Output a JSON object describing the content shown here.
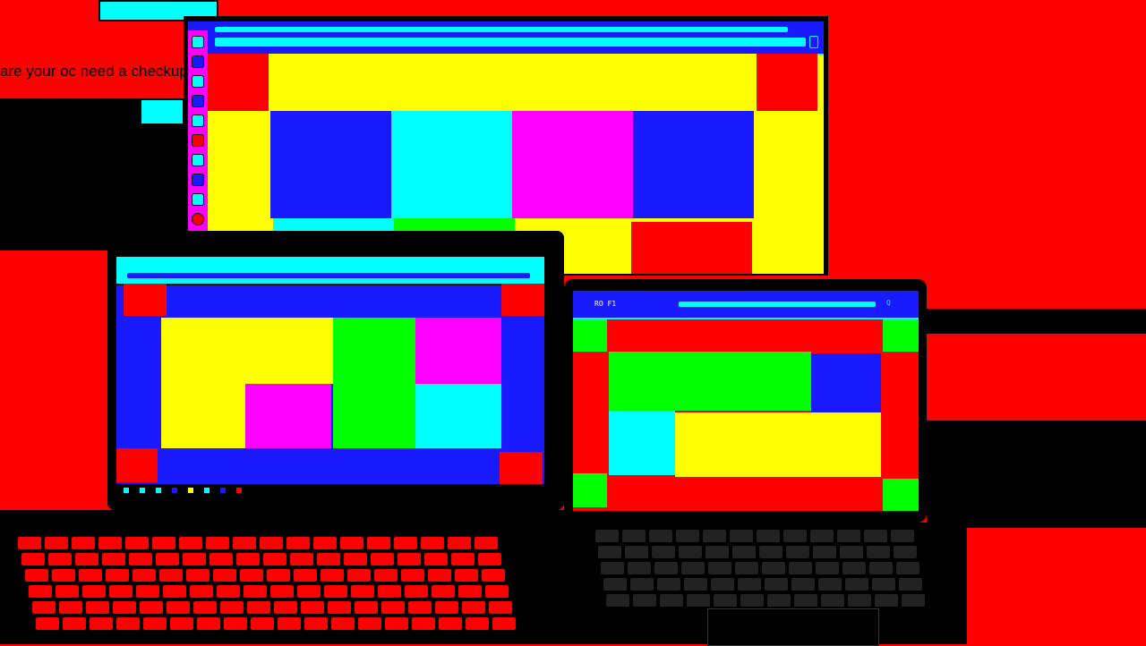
{
  "background_text": "are your oc need a checkup",
  "colors": {
    "wall": "#ff0000",
    "bezel": "#000000",
    "accent_blue": "#1a1aff",
    "accent_cyan": "#00ffff",
    "accent_yellow": "#ffff00",
    "accent_magenta": "#ff00ff",
    "accent_green": "#00ff00"
  },
  "monitor": {
    "dock_icons": [
      "browser-icon",
      "finder-icon",
      "mail-icon",
      "calendar-icon",
      "files-icon",
      "music-icon",
      "chat-icon",
      "settings-icon",
      "photos-icon",
      "chrome-icon"
    ]
  },
  "laptop_left": {
    "taskbar_icons": [
      "start-icon",
      "search-icon",
      "taskview-icon",
      "edge-icon",
      "explorer-icon",
      "store-icon",
      "mail-icon",
      "chrome-icon"
    ]
  },
  "laptop_right": {
    "title": "RO F1",
    "url": "",
    "search_label": "Q"
  }
}
